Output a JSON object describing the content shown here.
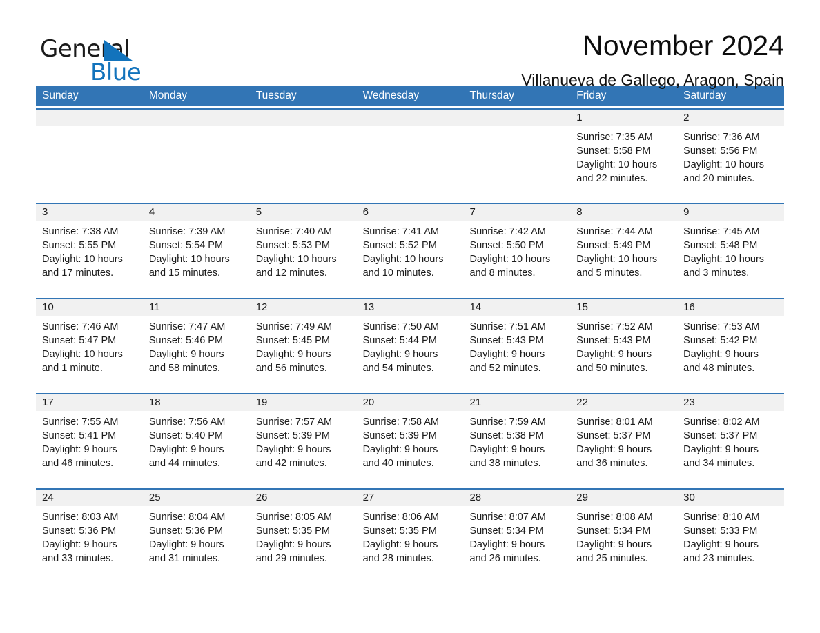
{
  "logo": {
    "word_one": "General",
    "word_two": "Blue",
    "triangle_icon": "triangle-icon",
    "brand_color": "#1273bc"
  },
  "header": {
    "title": "November 2024",
    "subtitle": "Villanueva de Gallego, Aragon, Spain"
  },
  "colors": {
    "header_blue": "#3275b5",
    "daynum_band": "#f1f1f1",
    "text": "#1c1c1c"
  },
  "calendar": {
    "weekdays": [
      "Sunday",
      "Monday",
      "Tuesday",
      "Wednesday",
      "Thursday",
      "Friday",
      "Saturday"
    ],
    "weeks": [
      {
        "numbers": [
          "",
          "",
          "",
          "",
          "",
          "1",
          "2"
        ],
        "cells": [
          {
            "empty": true,
            "sunrise": "",
            "sunset": "",
            "daylight_1": "",
            "daylight_2": ""
          },
          {
            "empty": true,
            "sunrise": "",
            "sunset": "",
            "daylight_1": "",
            "daylight_2": ""
          },
          {
            "empty": true,
            "sunrise": "",
            "sunset": "",
            "daylight_1": "",
            "daylight_2": ""
          },
          {
            "empty": true,
            "sunrise": "",
            "sunset": "",
            "daylight_1": "",
            "daylight_2": ""
          },
          {
            "empty": true,
            "sunrise": "",
            "sunset": "",
            "daylight_1": "",
            "daylight_2": ""
          },
          {
            "empty": false,
            "sunrise": "Sunrise: 7:35 AM",
            "sunset": "Sunset: 5:58 PM",
            "daylight_1": "Daylight: 10 hours",
            "daylight_2": "and 22 minutes."
          },
          {
            "empty": false,
            "sunrise": "Sunrise: 7:36 AM",
            "sunset": "Sunset: 5:56 PM",
            "daylight_1": "Daylight: 10 hours",
            "daylight_2": "and 20 minutes."
          }
        ]
      },
      {
        "numbers": [
          "3",
          "4",
          "5",
          "6",
          "7",
          "8",
          "9"
        ],
        "cells": [
          {
            "empty": false,
            "sunrise": "Sunrise: 7:38 AM",
            "sunset": "Sunset: 5:55 PM",
            "daylight_1": "Daylight: 10 hours",
            "daylight_2": "and 17 minutes."
          },
          {
            "empty": false,
            "sunrise": "Sunrise: 7:39 AM",
            "sunset": "Sunset: 5:54 PM",
            "daylight_1": "Daylight: 10 hours",
            "daylight_2": "and 15 minutes."
          },
          {
            "empty": false,
            "sunrise": "Sunrise: 7:40 AM",
            "sunset": "Sunset: 5:53 PM",
            "daylight_1": "Daylight: 10 hours",
            "daylight_2": "and 12 minutes."
          },
          {
            "empty": false,
            "sunrise": "Sunrise: 7:41 AM",
            "sunset": "Sunset: 5:52 PM",
            "daylight_1": "Daylight: 10 hours",
            "daylight_2": "and 10 minutes."
          },
          {
            "empty": false,
            "sunrise": "Sunrise: 7:42 AM",
            "sunset": "Sunset: 5:50 PM",
            "daylight_1": "Daylight: 10 hours",
            "daylight_2": "and 8 minutes."
          },
          {
            "empty": false,
            "sunrise": "Sunrise: 7:44 AM",
            "sunset": "Sunset: 5:49 PM",
            "daylight_1": "Daylight: 10 hours",
            "daylight_2": "and 5 minutes."
          },
          {
            "empty": false,
            "sunrise": "Sunrise: 7:45 AM",
            "sunset": "Sunset: 5:48 PM",
            "daylight_1": "Daylight: 10 hours",
            "daylight_2": "and 3 minutes."
          }
        ]
      },
      {
        "numbers": [
          "10",
          "11",
          "12",
          "13",
          "14",
          "15",
          "16"
        ],
        "cells": [
          {
            "empty": false,
            "sunrise": "Sunrise: 7:46 AM",
            "sunset": "Sunset: 5:47 PM",
            "daylight_1": "Daylight: 10 hours",
            "daylight_2": "and 1 minute."
          },
          {
            "empty": false,
            "sunrise": "Sunrise: 7:47 AM",
            "sunset": "Sunset: 5:46 PM",
            "daylight_1": "Daylight: 9 hours",
            "daylight_2": "and 58 minutes."
          },
          {
            "empty": false,
            "sunrise": "Sunrise: 7:49 AM",
            "sunset": "Sunset: 5:45 PM",
            "daylight_1": "Daylight: 9 hours",
            "daylight_2": "and 56 minutes."
          },
          {
            "empty": false,
            "sunrise": "Sunrise: 7:50 AM",
            "sunset": "Sunset: 5:44 PM",
            "daylight_1": "Daylight: 9 hours",
            "daylight_2": "and 54 minutes."
          },
          {
            "empty": false,
            "sunrise": "Sunrise: 7:51 AM",
            "sunset": "Sunset: 5:43 PM",
            "daylight_1": "Daylight: 9 hours",
            "daylight_2": "and 52 minutes."
          },
          {
            "empty": false,
            "sunrise": "Sunrise: 7:52 AM",
            "sunset": "Sunset: 5:43 PM",
            "daylight_1": "Daylight: 9 hours",
            "daylight_2": "and 50 minutes."
          },
          {
            "empty": false,
            "sunrise": "Sunrise: 7:53 AM",
            "sunset": "Sunset: 5:42 PM",
            "daylight_1": "Daylight: 9 hours",
            "daylight_2": "and 48 minutes."
          }
        ]
      },
      {
        "numbers": [
          "17",
          "18",
          "19",
          "20",
          "21",
          "22",
          "23"
        ],
        "cells": [
          {
            "empty": false,
            "sunrise": "Sunrise: 7:55 AM",
            "sunset": "Sunset: 5:41 PM",
            "daylight_1": "Daylight: 9 hours",
            "daylight_2": "and 46 minutes."
          },
          {
            "empty": false,
            "sunrise": "Sunrise: 7:56 AM",
            "sunset": "Sunset: 5:40 PM",
            "daylight_1": "Daylight: 9 hours",
            "daylight_2": "and 44 minutes."
          },
          {
            "empty": false,
            "sunrise": "Sunrise: 7:57 AM",
            "sunset": "Sunset: 5:39 PM",
            "daylight_1": "Daylight: 9 hours",
            "daylight_2": "and 42 minutes."
          },
          {
            "empty": false,
            "sunrise": "Sunrise: 7:58 AM",
            "sunset": "Sunset: 5:39 PM",
            "daylight_1": "Daylight: 9 hours",
            "daylight_2": "and 40 minutes."
          },
          {
            "empty": false,
            "sunrise": "Sunrise: 7:59 AM",
            "sunset": "Sunset: 5:38 PM",
            "daylight_1": "Daylight: 9 hours",
            "daylight_2": "and 38 minutes."
          },
          {
            "empty": false,
            "sunrise": "Sunrise: 8:01 AM",
            "sunset": "Sunset: 5:37 PM",
            "daylight_1": "Daylight: 9 hours",
            "daylight_2": "and 36 minutes."
          },
          {
            "empty": false,
            "sunrise": "Sunrise: 8:02 AM",
            "sunset": "Sunset: 5:37 PM",
            "daylight_1": "Daylight: 9 hours",
            "daylight_2": "and 34 minutes."
          }
        ]
      },
      {
        "numbers": [
          "24",
          "25",
          "26",
          "27",
          "28",
          "29",
          "30"
        ],
        "cells": [
          {
            "empty": false,
            "sunrise": "Sunrise: 8:03 AM",
            "sunset": "Sunset: 5:36 PM",
            "daylight_1": "Daylight: 9 hours",
            "daylight_2": "and 33 minutes."
          },
          {
            "empty": false,
            "sunrise": "Sunrise: 8:04 AM",
            "sunset": "Sunset: 5:36 PM",
            "daylight_1": "Daylight: 9 hours",
            "daylight_2": "and 31 minutes."
          },
          {
            "empty": false,
            "sunrise": "Sunrise: 8:05 AM",
            "sunset": "Sunset: 5:35 PM",
            "daylight_1": "Daylight: 9 hours",
            "daylight_2": "and 29 minutes."
          },
          {
            "empty": false,
            "sunrise": "Sunrise: 8:06 AM",
            "sunset": "Sunset: 5:35 PM",
            "daylight_1": "Daylight: 9 hours",
            "daylight_2": "and 28 minutes."
          },
          {
            "empty": false,
            "sunrise": "Sunrise: 8:07 AM",
            "sunset": "Sunset: 5:34 PM",
            "daylight_1": "Daylight: 9 hours",
            "daylight_2": "and 26 minutes."
          },
          {
            "empty": false,
            "sunrise": "Sunrise: 8:08 AM",
            "sunset": "Sunset: 5:34 PM",
            "daylight_1": "Daylight: 9 hours",
            "daylight_2": "and 25 minutes."
          },
          {
            "empty": false,
            "sunrise": "Sunrise: 8:10 AM",
            "sunset": "Sunset: 5:33 PM",
            "daylight_1": "Daylight: 9 hours",
            "daylight_2": "and 23 minutes."
          }
        ]
      }
    ]
  }
}
